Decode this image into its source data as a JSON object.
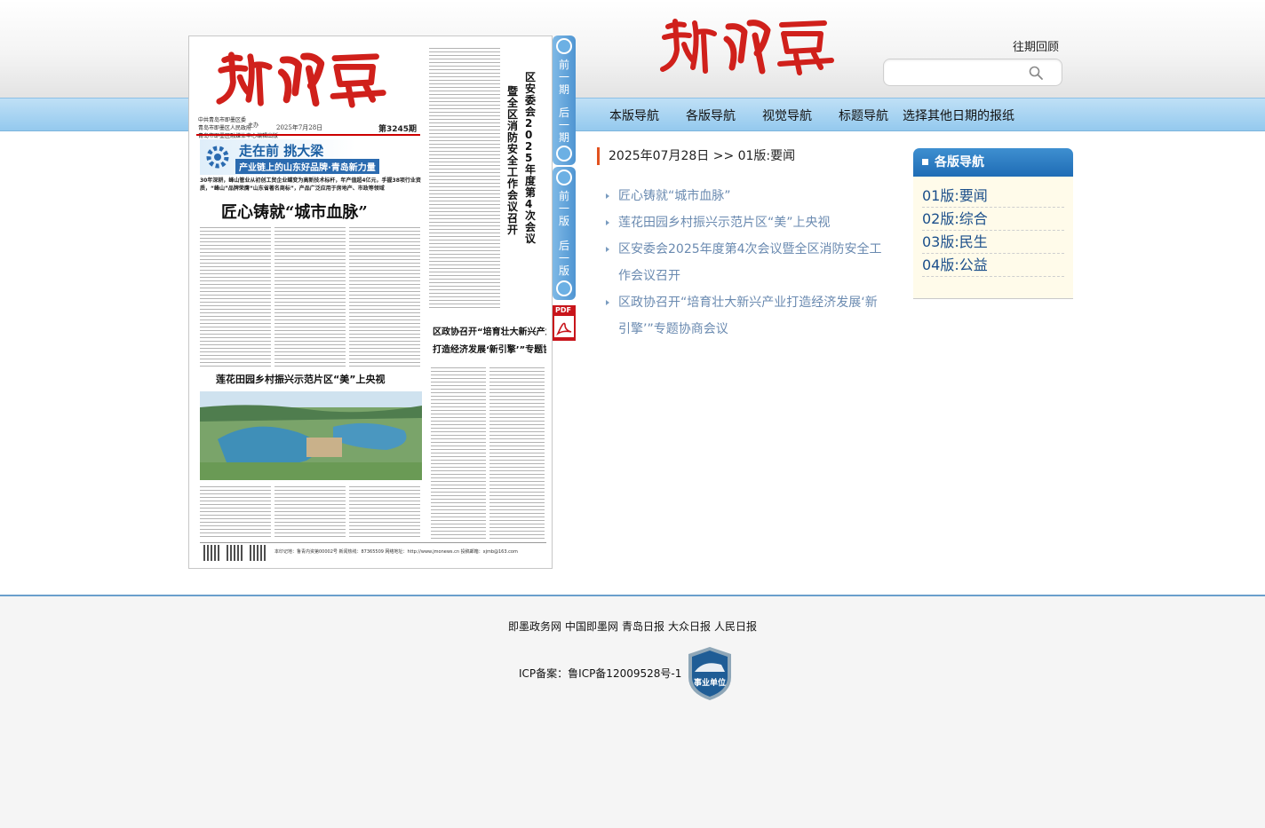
{
  "header": {
    "masthead": "新即墨",
    "archive_link": "往期回顾",
    "search": {
      "placeholder": ""
    }
  },
  "nav": {
    "items": [
      "本版导航",
      "各版导航",
      "视觉导航",
      "标题导航",
      "选择其他日期的报纸"
    ]
  },
  "paper_page": {
    "masthead": "新即墨",
    "meta_lines": [
      "中共青岛市即墨区委",
      "青岛市即墨区人民政府",
      "青岛市即墨区融媒体中心编辑出版"
    ],
    "meta_host": "主办",
    "date_text": "2025年7月28日",
    "issue": "第3245期",
    "banner_line1": "走在前 挑大梁",
    "banner_line2": "产业链上的山东好品牌·青岛新力量",
    "lead": "30年深耕，峰山管业从初创工贸企业蝶变为高新技术标杆，年产值超4亿元，手握38项行业资质，“峰山”品牌荣膺“山东省著名商标”，产品广泛应用于房地产、市政等领域",
    "headline": "匠心铸就“城市血脉”",
    "headline2": "莲花田园乡村振兴示范片区“美”上央视",
    "vertical_headline": [
      "区安委会2025年度第4次会议",
      "暨全区消防安全工作会议召开"
    ],
    "headline3_line1": "区政协召开“培育壮大新兴产业",
    "headline3_line2": "打造经济发展‘新引擎’”专题协商会议",
    "footer_text": "本印记地：鲁青内资第00002号   新闻热线：87365509   网络地址：http://www.jmonews.cn   投稿邮箱：xjmb@163.com"
  },
  "side_tabs": {
    "prev_issue": "前一期",
    "next_issue": "后一期",
    "prev_page": "前一版",
    "next_page": "后一版",
    "pdf": "PDF"
  },
  "breadcrumb": "2025年07月28日 >> 01版:要闻",
  "articles": [
    "匠心铸就“城市血脉”",
    "莲花田园乡村振兴示范片区“美”上央视",
    "区安委会2025年度第4次会议暨全区消防安全工作会议召开",
    "区政协召开“培育壮大新兴产业打造经济发展‘新引擎’”专题协商会议"
  ],
  "section_nav": {
    "title": "各版导航",
    "items": [
      "01版:要闻",
      "02版:综合",
      "03版:民生",
      "04版:公益"
    ]
  },
  "footer": {
    "links": [
      "即墨政务网",
      "中国即墨网",
      "青岛日报",
      "大众日报",
      "人民日报"
    ],
    "icp": "ICP备案：鲁ICP备12009528号-1",
    "badge_text": "事业单位"
  },
  "colors": {
    "masthead_red": "#d0201b",
    "nav_blue": "#94c9ee",
    "link_blue": "#6a8ab0",
    "accent_orange": "#e2521f",
    "section_title_blue": "#1f6cb5"
  }
}
